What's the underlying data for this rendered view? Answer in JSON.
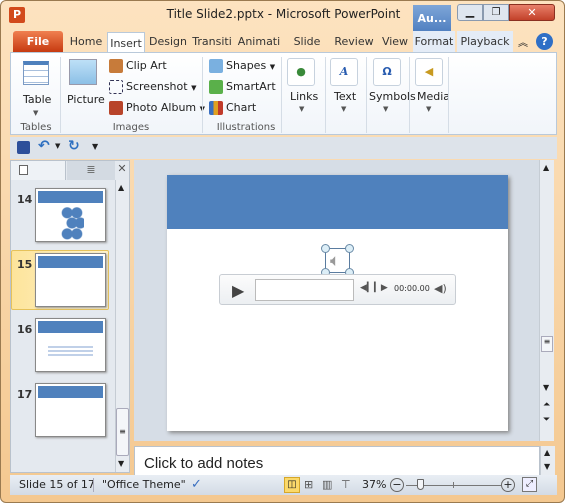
{
  "window": {
    "title": "Title Slide2.pptx  -  Microsoft PowerPoint",
    "context_tab": "Au..."
  },
  "tabs": [
    {
      "label": "File"
    },
    {
      "label": "Home"
    },
    {
      "label": "Insert"
    },
    {
      "label": "Design"
    },
    {
      "label": "Transiti"
    },
    {
      "label": "Animati"
    },
    {
      "label": "Slide Sh"
    },
    {
      "label": "Review"
    },
    {
      "label": "View"
    },
    {
      "label": "Format"
    },
    {
      "label": "Playback"
    }
  ],
  "ribbon": {
    "groups": {
      "tables": "Tables",
      "images": "Images",
      "illustrations": "Illustrations"
    },
    "table": "Table",
    "picture": "Picture",
    "clip_art": "Clip Art",
    "screenshot": "Screenshot",
    "photo_album": "Photo Album",
    "shapes": "Shapes",
    "smartart": "SmartArt",
    "chart": "Chart",
    "links": "Links",
    "text": "Text",
    "symbols": "Symbols",
    "media": "Media"
  },
  "slides": [
    {
      "number": "14"
    },
    {
      "number": "15"
    },
    {
      "number": "16"
    },
    {
      "number": "17"
    }
  ],
  "selected_slide": "15",
  "media_player": {
    "time": "00:00.00"
  },
  "notes": {
    "placeholder": "Click to add notes"
  },
  "status": {
    "slide": "Slide 15 of 17",
    "theme": "\"Office Theme\"",
    "zoom": "37%",
    "zoom_slider_percent": 37
  },
  "colors": {
    "accent": "#4f81bd",
    "file_tab": "#d24a1c"
  }
}
